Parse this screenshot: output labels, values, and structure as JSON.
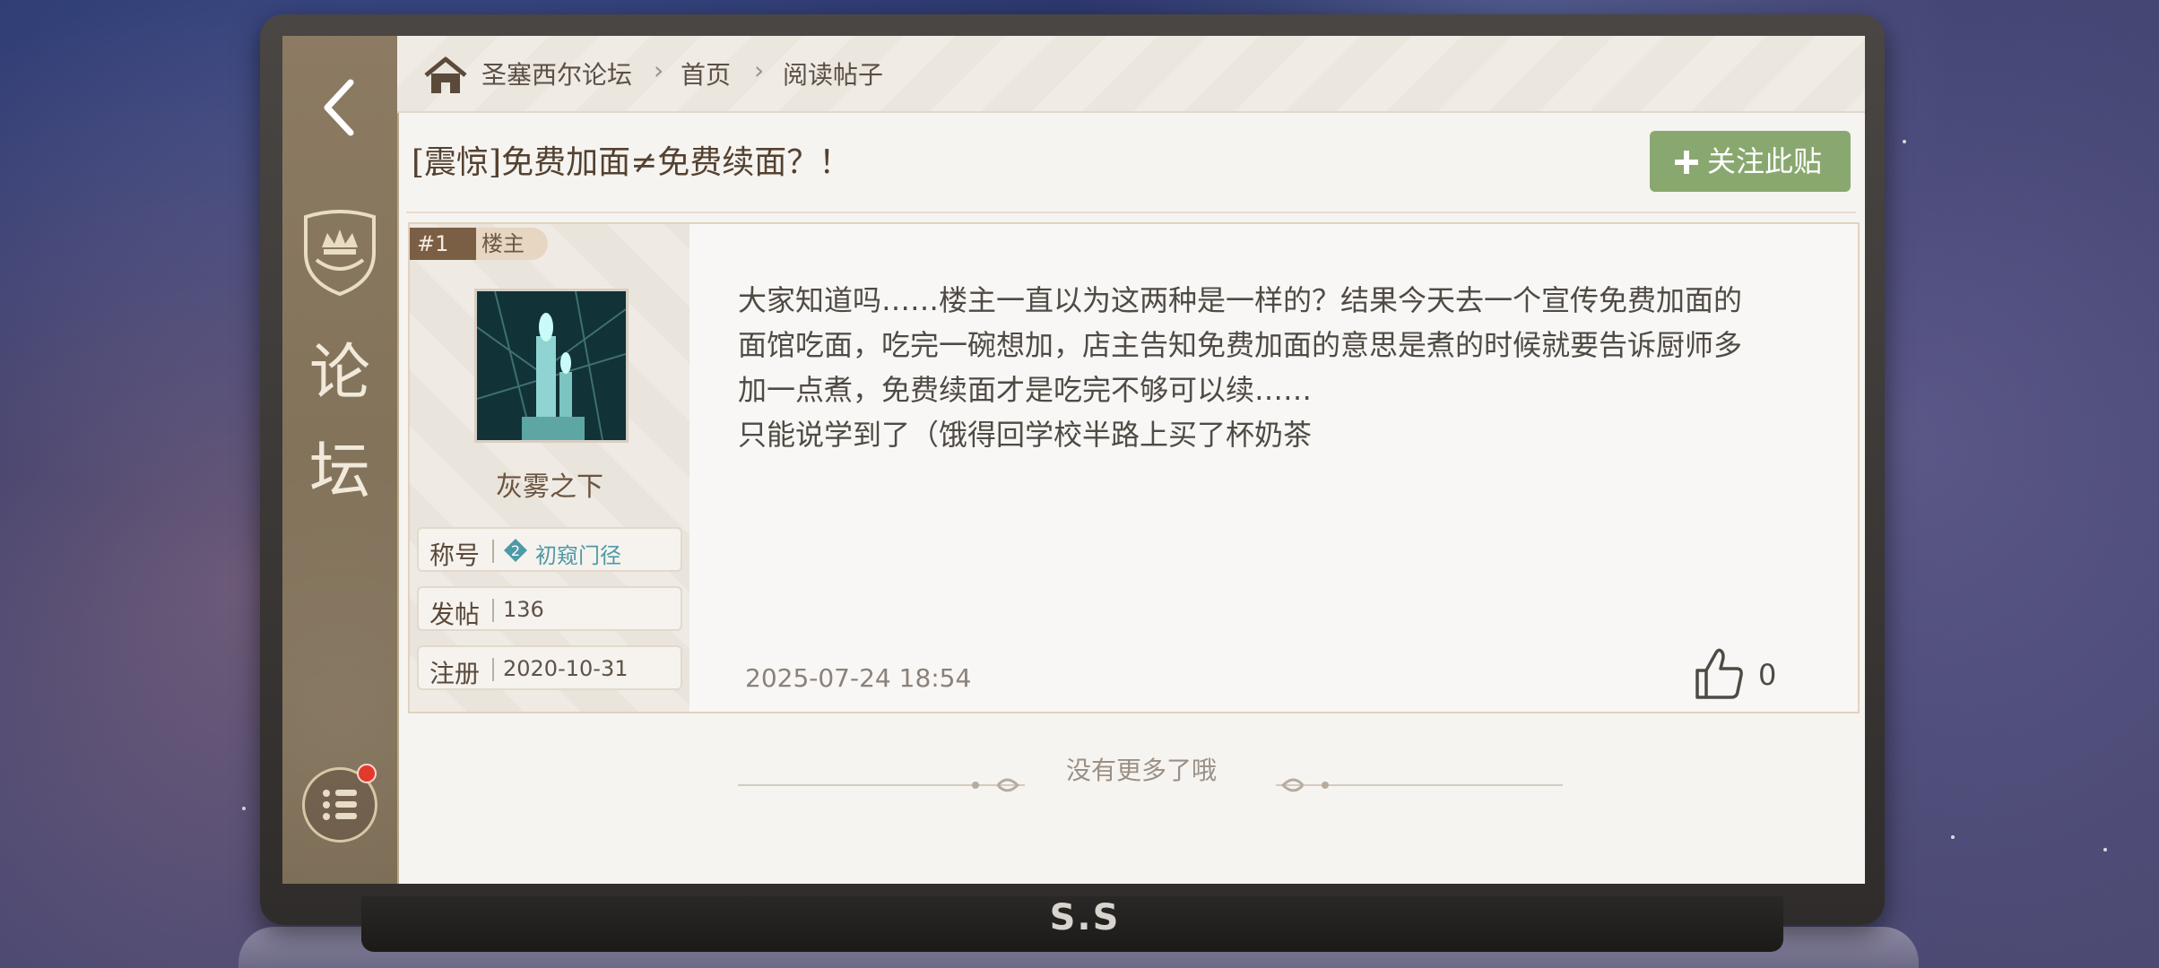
{
  "breadcrumb": {
    "forum": "圣塞西尔论坛",
    "home": "首页",
    "current": "阅读帖子"
  },
  "sidebar": {
    "title_line1": "论",
    "title_line2": "坛"
  },
  "post": {
    "title": "[震惊]免费加面≠免费续面？！",
    "follow_label": "关注此贴",
    "floor_number": "#1",
    "floor_tag": "楼主",
    "username": "灰雾之下",
    "info": {
      "title_label": "称号",
      "title_value": "初窥门径",
      "posts_label": "发帖",
      "posts_value": "136",
      "register_label": "注册",
      "register_value": "2020-10-31"
    },
    "body_lines": [
      "大家知道吗……楼主一直以为这两种是一样的？结果今天去一个宣传免费加面的",
      "面馆吃面，吃完一碗想加，店主告知免费加面的意思是煮的时候就要告诉厨师多",
      "加一点煮，免费续面才是吃完不够可以续……",
      "只能说学到了（饿得回学校半路上买了杯奶茶"
    ],
    "time": "2025-07-24  18:54",
    "like_count": "0"
  },
  "footer": {
    "end_text": "没有更多了哦"
  },
  "device": {
    "logo": "S.S"
  },
  "colors": {
    "follow_button": "#89a86f",
    "sidebar": "#8c7b62",
    "notification_dot": "#e23a2a",
    "title_badge": "#4e9aa6"
  },
  "icons": {
    "back": "chevron-left-icon",
    "home": "home-icon",
    "crest": "crest-icon",
    "menu": "list-icon",
    "like": "thumbs-up-icon",
    "plus": "plus-icon"
  }
}
